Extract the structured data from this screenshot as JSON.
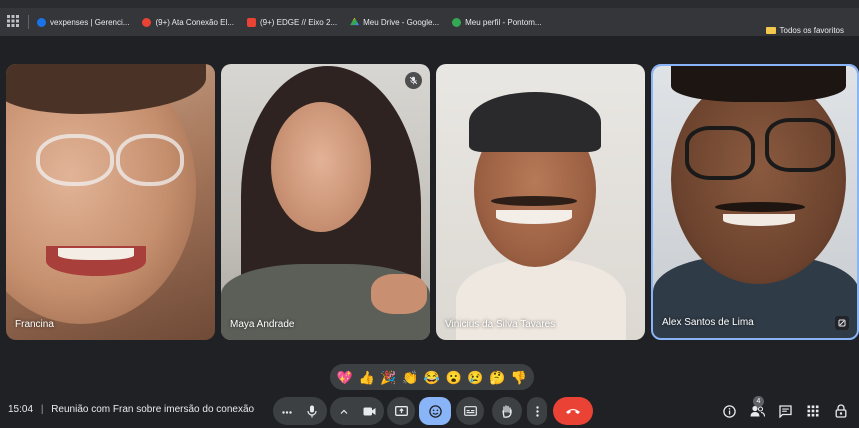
{
  "bookmarks": {
    "items": [
      {
        "label": "vexpenses | Gerenci...",
        "color": "#1a73e8"
      },
      {
        "label": "(9+) Ata Conexão El...",
        "color": "#ea4335"
      },
      {
        "label": "(9+) EDGE // Eixo 2...",
        "color": "#ea4335"
      },
      {
        "label": "Meu Drive - Google...",
        "color": "#fbbc04"
      },
      {
        "label": "Meu perfil - Pontom...",
        "color": "#34a853"
      }
    ],
    "all_bookmarks": "Todos os favoritos"
  },
  "participants": [
    {
      "name": "Francina"
    },
    {
      "name": "Maya Andrade",
      "muted": true
    },
    {
      "name": "Vinicius da Silva Tavares"
    },
    {
      "name": "Alex Santos de Lima",
      "active_speaker": true
    }
  ],
  "reactions": [
    "💖",
    "👍",
    "🎉",
    "👏",
    "😂",
    "😮",
    "😢",
    "🤔",
    "👎"
  ],
  "meeting": {
    "time": "15:04",
    "separator": "|",
    "title": "Reunião com Fran sobre imersão do conexão"
  },
  "people_count": "4",
  "colors": {
    "background": "#202124",
    "control": "#3c4043",
    "reaction_active": "#8ab4f8",
    "hangup": "#ea4335"
  }
}
